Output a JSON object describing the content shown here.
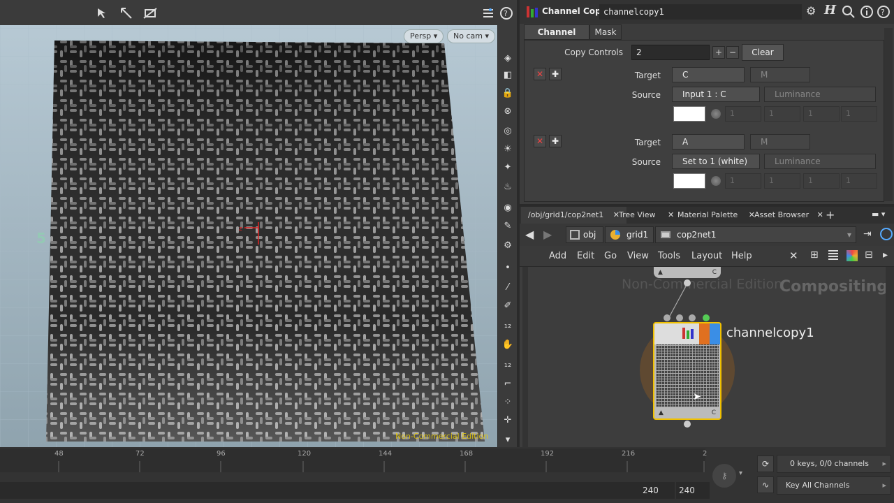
{
  "viewport": {
    "persp_label": "Persp",
    "cam_label": "No cam",
    "watermark": "Non-Commercial Edition",
    "axis_z": "z"
  },
  "param": {
    "node_type": "Channel Copy",
    "node_name": "channelcopy1",
    "tabs": [
      "Channel Copy",
      "Mask"
    ],
    "copy_controls_label": "Copy Controls",
    "copy_controls_value": "2",
    "clear_label": "Clear",
    "block1": {
      "target_label": "Target",
      "target_value": "C",
      "target_m": "M",
      "source_label": "Source",
      "source_value": "Input 1 : C",
      "source_mode": "Luminance",
      "vals": [
        "1",
        "1",
        "1",
        "1"
      ]
    },
    "block2": {
      "target_label": "Target",
      "target_value": "A",
      "target_m": "M",
      "source_label": "Source",
      "source_value": "Set to 1 (white)",
      "source_mode": "Luminance",
      "vals": [
        "1",
        "1",
        "1",
        "1"
      ]
    }
  },
  "network": {
    "tabs": [
      "/obj/grid1/cop2net1",
      "Tree View",
      "Material Palette",
      "Asset Browser"
    ],
    "path": [
      "obj",
      "grid1",
      "cop2net1"
    ],
    "menu": [
      "Add",
      "Edit",
      "Go",
      "View",
      "Tools",
      "Layout",
      "Help"
    ],
    "watermark": "Non-Commercial Edition",
    "context": "Compositing",
    "node_label": "channelcopy1",
    "node_flag": "C"
  },
  "timeline": {
    "ticks": [
      "48",
      "72",
      "96",
      "120",
      "144",
      "168",
      "192",
      "216",
      "2"
    ],
    "end1": "240",
    "end2": "240",
    "keys_info": "0 keys, 0/0 channels",
    "key_all": "Key All Channels"
  },
  "colors": {
    "accent": "#f0c000",
    "brand_blue": "#3a8ee6"
  }
}
